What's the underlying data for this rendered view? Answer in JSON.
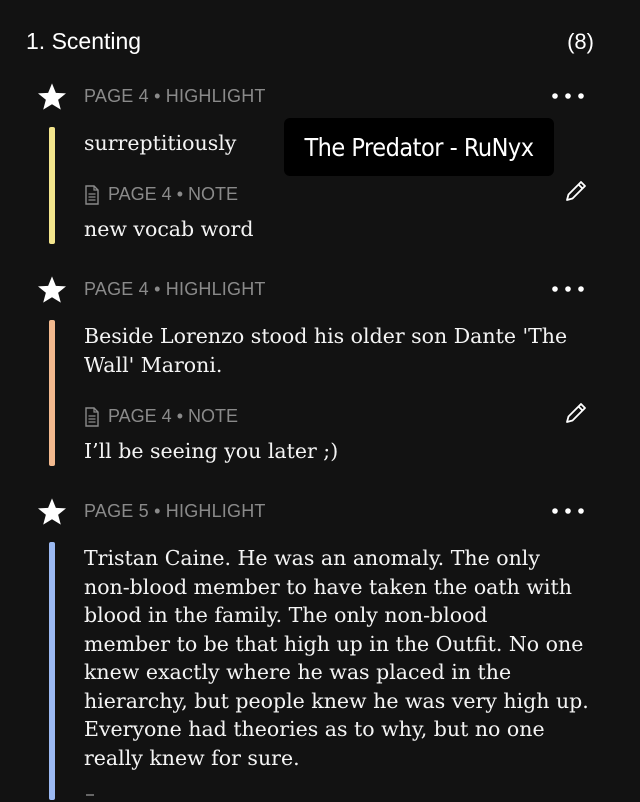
{
  "header": {
    "chapter_title": "1. Scenting",
    "count": "(8)"
  },
  "overlay_label": "The Predator - RuNyx",
  "colors": {
    "yellow": "#f3e58c",
    "orange": "#f2b98e",
    "blue": "#9bb9f2",
    "meta_gray": "#8a8a8a"
  },
  "entries": [
    {
      "meta": "PAGE 4 • HIGHLIGHT",
      "quote": "surreptitiously",
      "note_meta": "PAGE 4 • NOTE",
      "note": "new vocab word",
      "highlight_color": "yellow"
    },
    {
      "meta": "PAGE 4 • HIGHLIGHT",
      "quote_lines": [
        "Beside Lorenzo stood his older son Dante 'The",
        "Wall' Maroni."
      ],
      "note_meta": "PAGE 4 • NOTE",
      "note": "I’ll be seeing you later ;)",
      "highlight_color": "orange"
    },
    {
      "meta": "PAGE 5 • HIGHLIGHT",
      "quote_lines": [
        "Tristan Caine. He was an anomaly. The only",
        "non-blood member to have taken the oath with",
        "blood in the family. The only non-blood",
        "member to be that high up in the Outfit. No one",
        "knew exactly where he was placed in the",
        "hierarchy, but people knew he was very high up.",
        "Everyone had theories as to why, but no one",
        "really knew for sure."
      ],
      "highlight_color": "blue"
    }
  ]
}
